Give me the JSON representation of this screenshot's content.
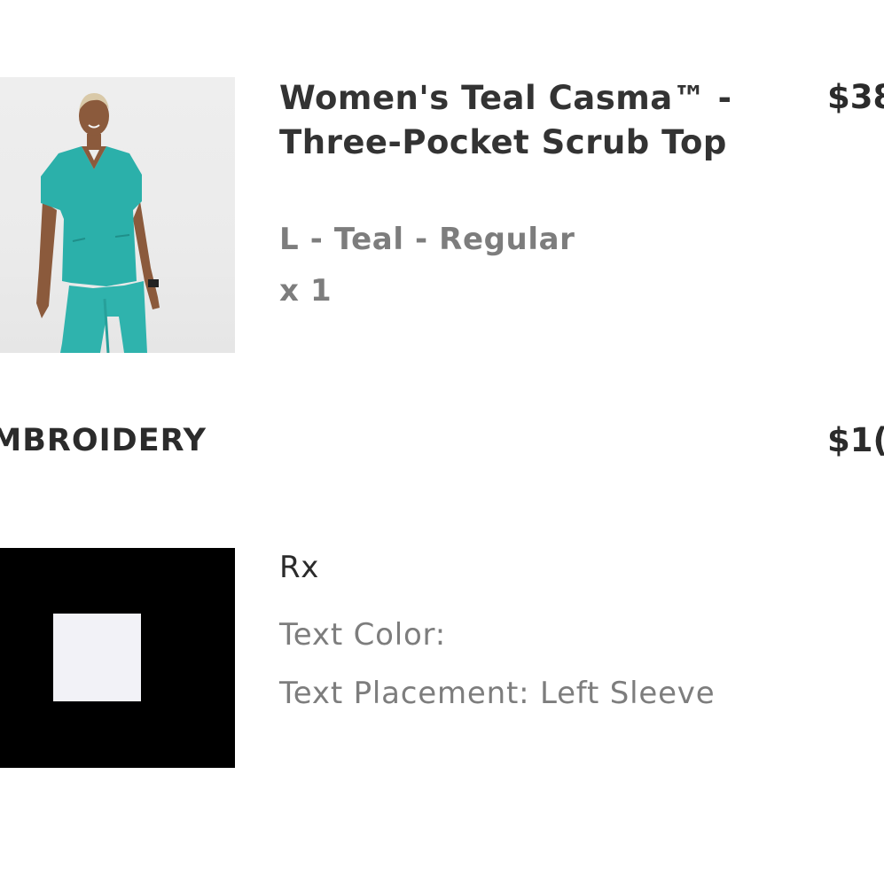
{
  "cart_item": {
    "title": "Women's Teal Casma™ - Three-Pocket Scrub Top",
    "variant": "L - Teal - Regular",
    "quantity": "x 1",
    "price": "$38",
    "image_icon": "scrub-top-model-photo",
    "garment_color": "#2bb0aa"
  },
  "embroidery": {
    "heading": "MBROIDERY",
    "price": "$1(",
    "text_value": "Rx",
    "text_color_label": "Text Color:",
    "text_placement_label": "Text Placement: Left Sleeve",
    "swatch_color": "#f2f2f7",
    "swatch_frame_color": "#000000"
  }
}
